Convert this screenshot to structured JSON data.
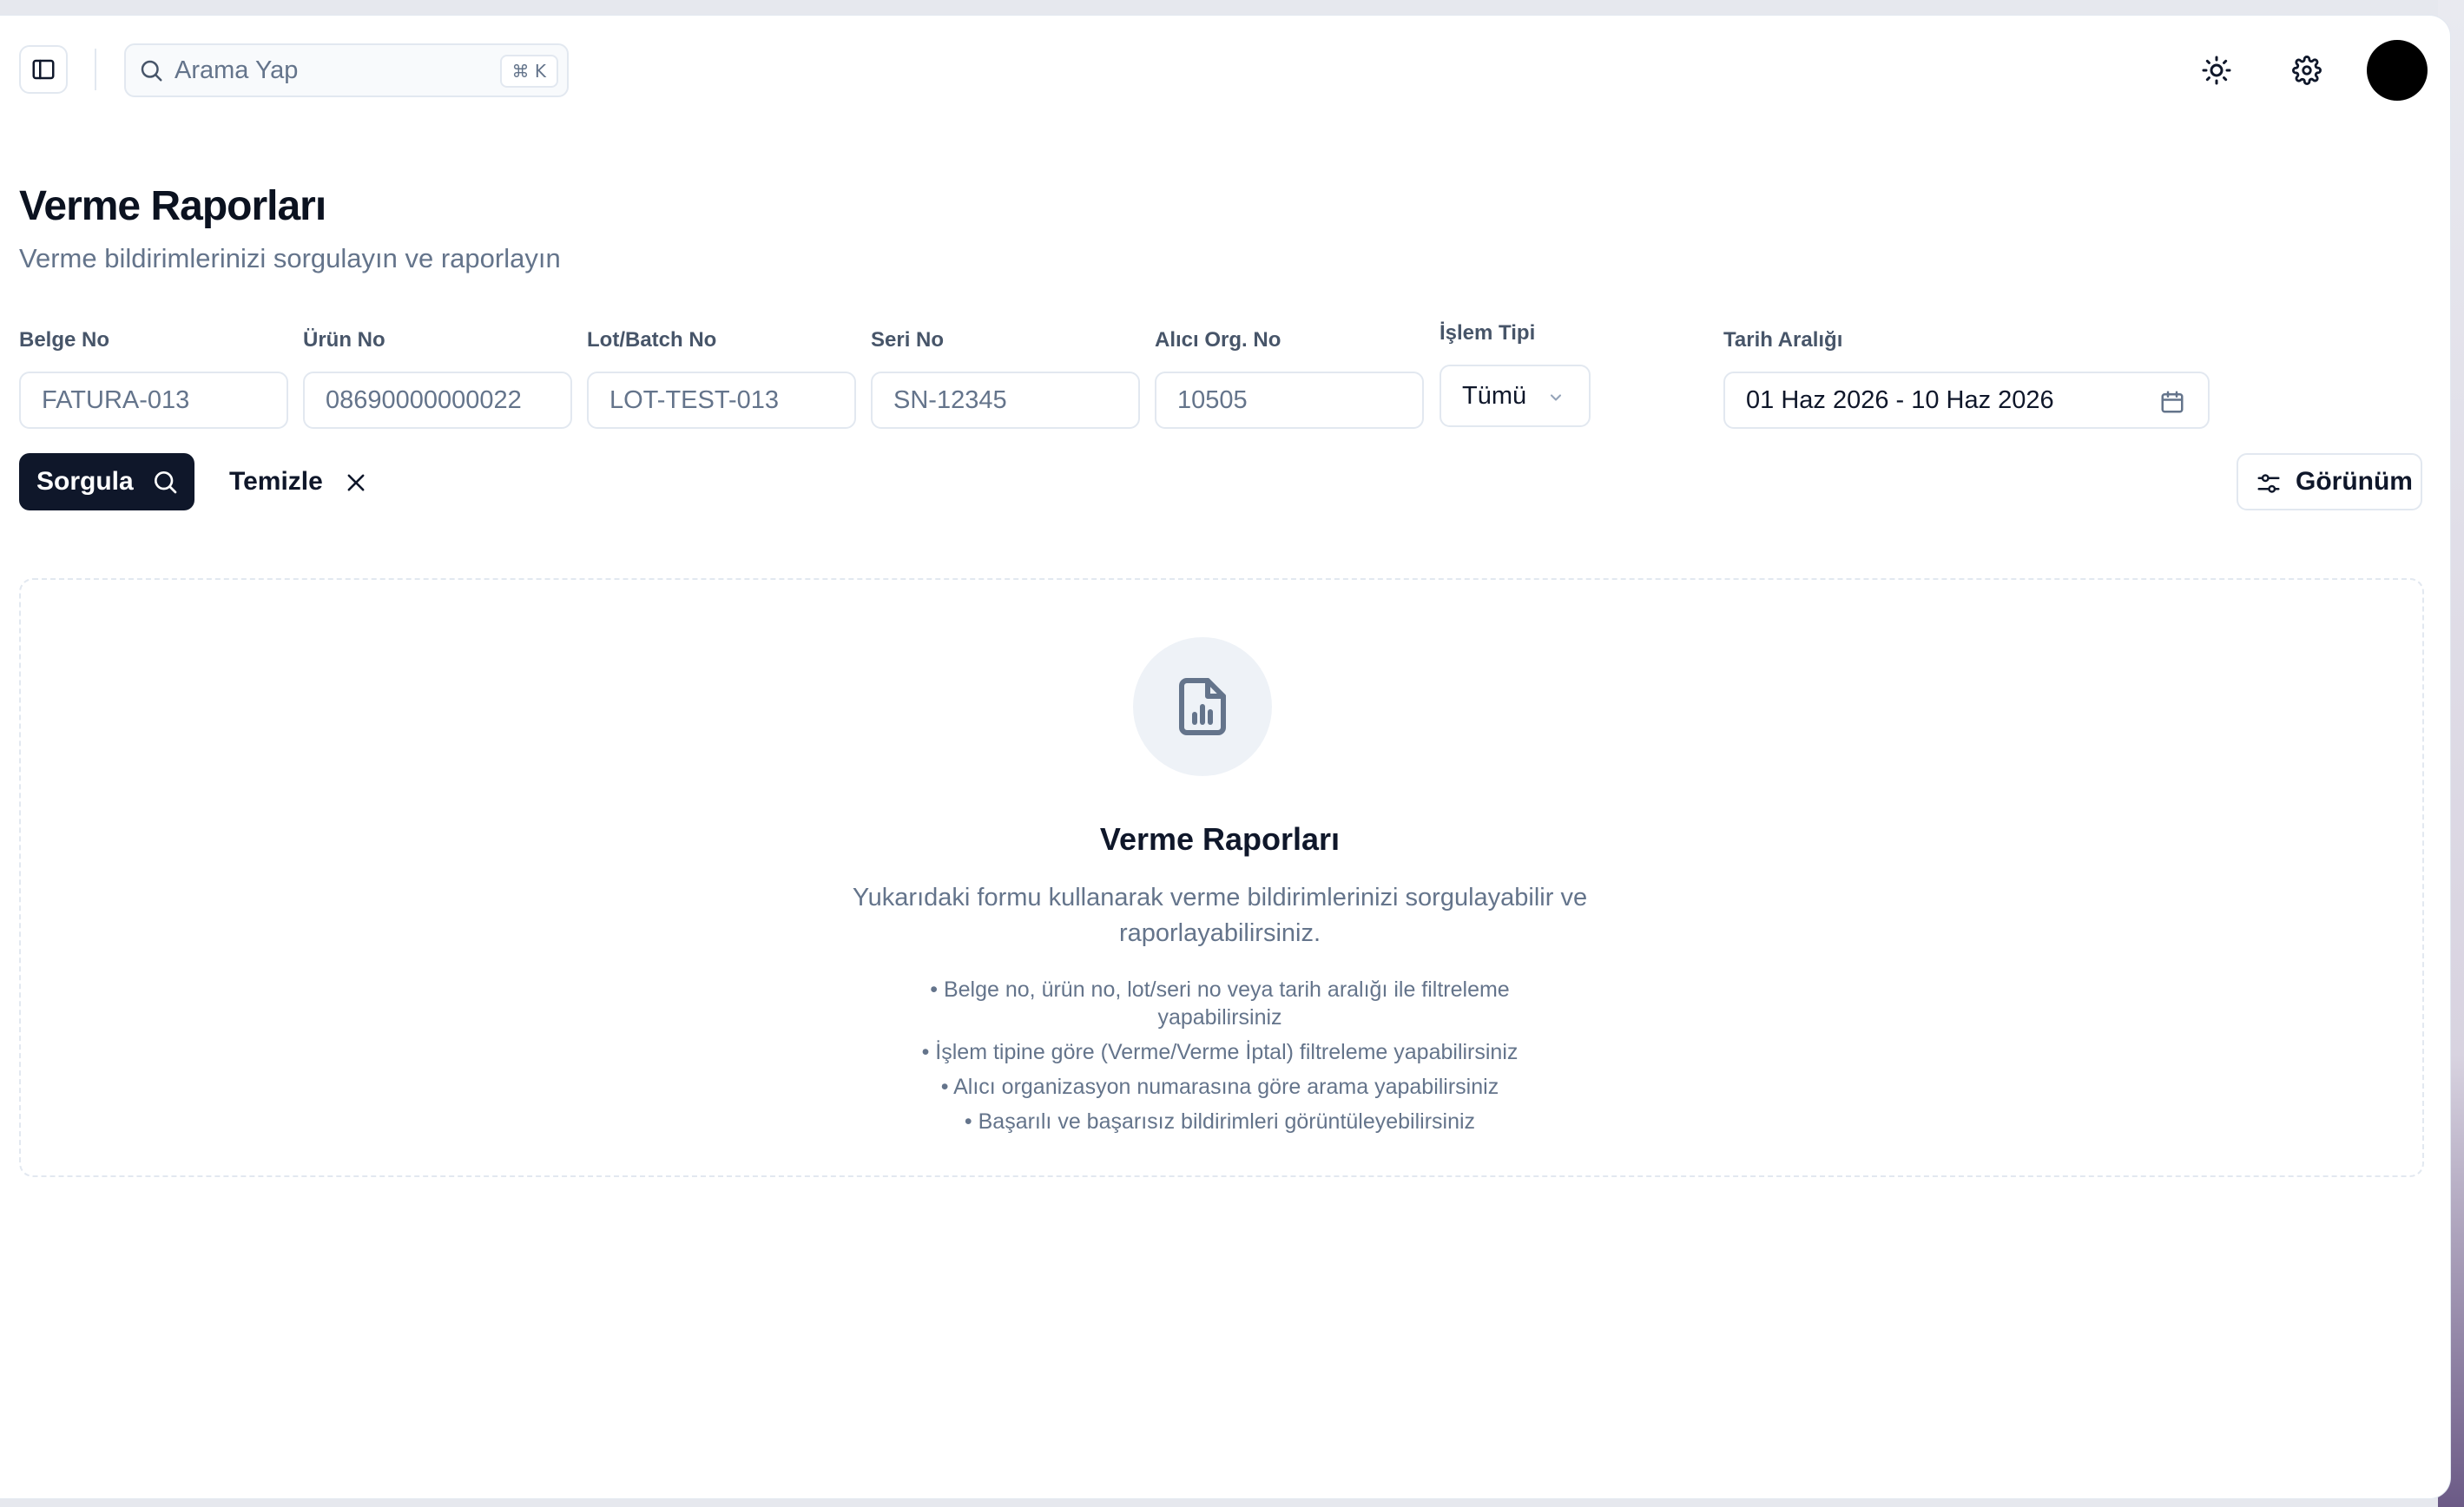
{
  "topbar": {
    "search_placeholder": "Arama Yap",
    "search_shortcut": "⌘ K"
  },
  "header": {
    "title": "Verme Raporları",
    "subtitle": "Verme bildirimlerinizi sorgulayın ve raporlayın"
  },
  "filters": {
    "belge_no": {
      "label": "Belge No",
      "value": "FATURA-013"
    },
    "urun_no": {
      "label": "Ürün No",
      "value": "08690000000022"
    },
    "lot_no": {
      "label": "Lot/Batch No",
      "value": "LOT-TEST-013"
    },
    "seri_no": {
      "label": "Seri No",
      "value": "SN-12345"
    },
    "alici_org": {
      "label": "Alıcı Org. No",
      "value": "10505"
    },
    "islem_tipi": {
      "label": "İşlem Tipi",
      "value": "Tümü"
    },
    "tarih": {
      "label": "Tarih Aralığı",
      "value": "01 Haz 2026 - 10 Haz 2026"
    }
  },
  "actions": {
    "query_label": "Sorgula",
    "clear_label": "Temizle",
    "view_label": "Görünüm"
  },
  "empty_state": {
    "title": "Verme Raporları",
    "description": "Yukarıdaki formu kullanarak verme bildirimlerinizi sorgulayabilir ve raporlayabilirsiniz.",
    "tips": [
      "• Belge no, ürün no, lot/seri no veya tarih aralığı ile filtreleme yapabilirsiniz",
      "• İşlem tipine göre (Verme/Verme İptal) filtreleme yapabilirsiniz",
      "• Alıcı organizasyon numarasına göre arama yapabilirsiniz",
      "• Başarılı ve başarısız bildirimleri görüntüleyebilirsiniz"
    ]
  },
  "icons": {
    "sidebar_toggle": "sidebar-panel-icon",
    "search": "search-icon",
    "theme": "sun-icon",
    "settings": "gear-icon",
    "calendar": "calendar-icon",
    "chevron": "chevron-down-icon",
    "close": "close-icon",
    "view": "sliders-icon",
    "report": "file-chart-icon"
  },
  "colors": {
    "primary": "#0f172a",
    "muted_text": "#64748b",
    "border": "#e2e8f0",
    "icon_bg": "#eef2f7"
  }
}
